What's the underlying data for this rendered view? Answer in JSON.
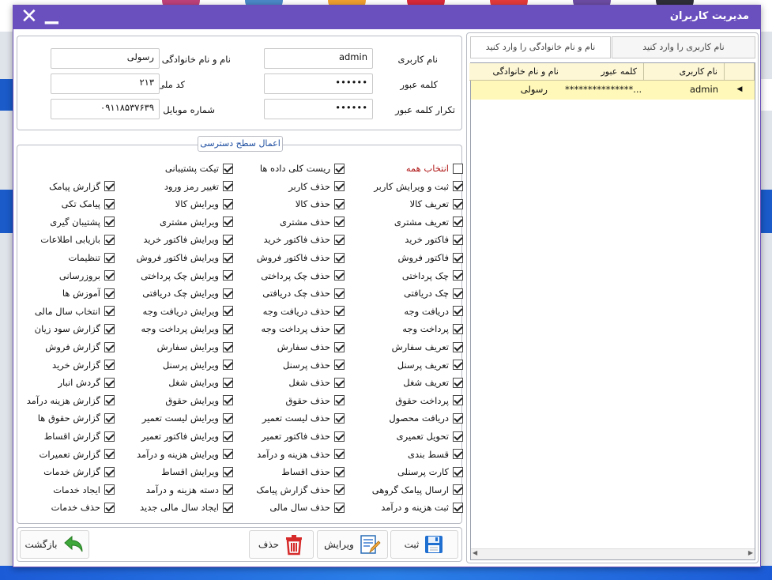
{
  "window": {
    "title": "مدیریت کاربران",
    "close_glyph": "✕",
    "minimize_glyph": "▁"
  },
  "form": {
    "username_label": "نام کاربری",
    "username_value": "admin",
    "fullname_label": "نام و نام خانوادگی",
    "fullname_value": "رسولی",
    "password_label": "کلمه عبور",
    "password_value": "••••••",
    "nationalcode_label": "کد ملی",
    "nationalcode_value": "۲۱۳",
    "confirm_label": "تکرار کلمه عبور",
    "confirm_value": "••••••",
    "mobile_label": "شماره موبایل",
    "mobile_value": "۰۹۱۱۸۵۳۷۶۳۹"
  },
  "permissions": {
    "legend": "اعمال سطح دسترسی",
    "col1": [
      {
        "label": "انتخاب همه",
        "checked": false,
        "red": true
      },
      {
        "label": "ثبت و ویرایش کاربر",
        "checked": true
      },
      {
        "label": "تعریف کالا",
        "checked": true
      },
      {
        "label": "تعریف مشتری",
        "checked": true
      },
      {
        "label": "فاکتور خرید",
        "checked": true
      },
      {
        "label": "فاکتور فروش",
        "checked": true
      },
      {
        "label": "چک پرداختی",
        "checked": true
      },
      {
        "label": "چک دریافتی",
        "checked": true
      },
      {
        "label": "دریافت وجه",
        "checked": true
      },
      {
        "label": "پرداخت وجه",
        "checked": true
      },
      {
        "label": "تعریف سفارش",
        "checked": true
      },
      {
        "label": "تعریف پرسنل",
        "checked": true
      },
      {
        "label": "تعریف شغل",
        "checked": true
      },
      {
        "label": "پرداخت حقوق",
        "checked": true
      },
      {
        "label": "دریافت محصول",
        "checked": true
      },
      {
        "label": "تحویل تعمیری",
        "checked": true
      },
      {
        "label": "قسط بندی",
        "checked": true
      },
      {
        "label": "کارت پرسنلی",
        "checked": true
      },
      {
        "label": "ارسال پیامک گروهی",
        "checked": true
      },
      {
        "label": "ثبت هزینه و درآمد",
        "checked": true
      }
    ],
    "col2": [
      {
        "label": "ریست کلی داده ها",
        "checked": true
      },
      {
        "label": "حذف کاربر",
        "checked": true
      },
      {
        "label": "حذف کالا",
        "checked": true
      },
      {
        "label": "حذف مشتری",
        "checked": true
      },
      {
        "label": "حذف فاکتور خرید",
        "checked": true
      },
      {
        "label": "حذف فاکتور فروش",
        "checked": true
      },
      {
        "label": "حذف چک پرداختی",
        "checked": true
      },
      {
        "label": "حذف چک دریافتی",
        "checked": true
      },
      {
        "label": "حذف دریافت وجه",
        "checked": true
      },
      {
        "label": "حذف پرداخت وجه",
        "checked": true
      },
      {
        "label": "حذف سفارش",
        "checked": true
      },
      {
        "label": "حذف پرسنل",
        "checked": true
      },
      {
        "label": "حذف شغل",
        "checked": true
      },
      {
        "label": "حذف حقوق",
        "checked": true
      },
      {
        "label": "حذف لیست تعمیر",
        "checked": true
      },
      {
        "label": "حذف فاکتور تعمیر",
        "checked": true
      },
      {
        "label": "حذف هزینه و درآمد",
        "checked": true
      },
      {
        "label": "حذف اقساط",
        "checked": true
      },
      {
        "label": "حذف گزارش پیامک",
        "checked": true
      },
      {
        "label": "حذف سال مالی",
        "checked": true
      }
    ],
    "col3": [
      {
        "label": "تیکت پشتیبانی",
        "checked": true
      },
      {
        "label": "تغییر رمز ورود",
        "checked": true
      },
      {
        "label": "ویرایش کالا",
        "checked": true
      },
      {
        "label": "ویرایش مشتری",
        "checked": true
      },
      {
        "label": "ویرایش فاکتور خرید",
        "checked": true
      },
      {
        "label": "ویرایش فاکتور فروش",
        "checked": true
      },
      {
        "label": "ویرایش چک پرداختی",
        "checked": true
      },
      {
        "label": "ویرایش چک دریافتی",
        "checked": true
      },
      {
        "label": "ویرایش دریافت وجه",
        "checked": true
      },
      {
        "label": "ویرایش پرداخت وجه",
        "checked": true
      },
      {
        "label": "ویرایش سفارش",
        "checked": true
      },
      {
        "label": "ویرایش پرسنل",
        "checked": true
      },
      {
        "label": "ویرایش شغل",
        "checked": true
      },
      {
        "label": "ویرایش حقوق",
        "checked": true
      },
      {
        "label": "ویرایش لیست تعمیر",
        "checked": true
      },
      {
        "label": "ویرایش فاکتور تعمیر",
        "checked": true
      },
      {
        "label": "ویرایش هزینه و درآمد",
        "checked": true
      },
      {
        "label": "ویرایش اقساط",
        "checked": true
      },
      {
        "label": "دسته هزینه و درآمد",
        "checked": true
      },
      {
        "label": "ایجاد سال مالی جدید",
        "checked": true
      }
    ],
    "col4": [
      null,
      {
        "label": "گزارش پیامک",
        "checked": true
      },
      {
        "label": "پیامک تکی",
        "checked": true
      },
      {
        "label": "پشتیبان گیری",
        "checked": true
      },
      {
        "label": "بازیابی اطلاعات",
        "checked": true
      },
      {
        "label": "تنظیمات",
        "checked": true
      },
      {
        "label": "بروزرسانی",
        "checked": true
      },
      {
        "label": "آموزش ها",
        "checked": true
      },
      {
        "label": "انتخاب سال مالی",
        "checked": true
      },
      {
        "label": "گزارش سود زیان",
        "checked": true
      },
      {
        "label": "گزارش فروش",
        "checked": true
      },
      {
        "label": "گزارش خرید",
        "checked": true
      },
      {
        "label": "گردش انبار",
        "checked": true
      },
      {
        "label": "گزارش هزینه درآمد",
        "checked": true
      },
      {
        "label": "گزارش حقوق ها",
        "checked": true
      },
      {
        "label": "گزارش اقساط",
        "checked": true
      },
      {
        "label": "گزارش تعمیرات",
        "checked": true
      },
      {
        "label": "گزارش خدمات",
        "checked": true
      },
      {
        "label": "ایجاد خدمات",
        "checked": true
      },
      {
        "label": "حذف خدمات",
        "checked": true
      }
    ]
  },
  "buttons": {
    "save": "ثبت",
    "edit": "ویرایش",
    "delete": "حذف",
    "back": "بازگشت"
  },
  "search": {
    "by_username": "نام کاربری را وارد کنید",
    "by_fullname": "نام و نام خانوادگی را وارد کنید"
  },
  "grid": {
    "headers": {
      "username": "نام کاربری",
      "password": "کلمه عبور",
      "fullname": "نام و نام خانوادگی"
    },
    "rows": [
      {
        "username": "admin",
        "password": "***************...",
        "fullname": "رسولی"
      }
    ]
  },
  "colors": {
    "titlebar": "#6a4fbe",
    "selected_row": "#fff8b8",
    "grid_header": "#fdf7d6"
  }
}
